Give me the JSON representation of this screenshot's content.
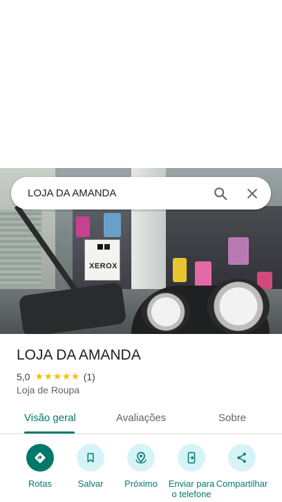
{
  "search": {
    "query": "LOJA DA AMANDA"
  },
  "photo": {
    "sign_text": "XEROX"
  },
  "place": {
    "name": "LOJA DA AMANDA",
    "rating": "5,0",
    "stars": "★★★★★",
    "review_count": "(1)",
    "category": "Loja de Roupa"
  },
  "tabs": [
    {
      "label": "Visão geral",
      "active": true
    },
    {
      "label": "Avaliações",
      "active": false
    },
    {
      "label": "Sobre",
      "active": false
    }
  ],
  "actions": [
    {
      "label": "Rotas",
      "icon": "directions-icon"
    },
    {
      "label": "Salvar",
      "icon": "bookmark-icon"
    },
    {
      "label": "Próximo",
      "icon": "nearby-icon"
    },
    {
      "label": "Enviar para o telefone",
      "icon": "send-to-phone-icon"
    },
    {
      "label": "Compartilhar",
      "icon": "share-icon"
    }
  ],
  "colors": {
    "accent": "#00796b",
    "action_bg": "#d6f3f8",
    "star": "#fbbc04"
  }
}
